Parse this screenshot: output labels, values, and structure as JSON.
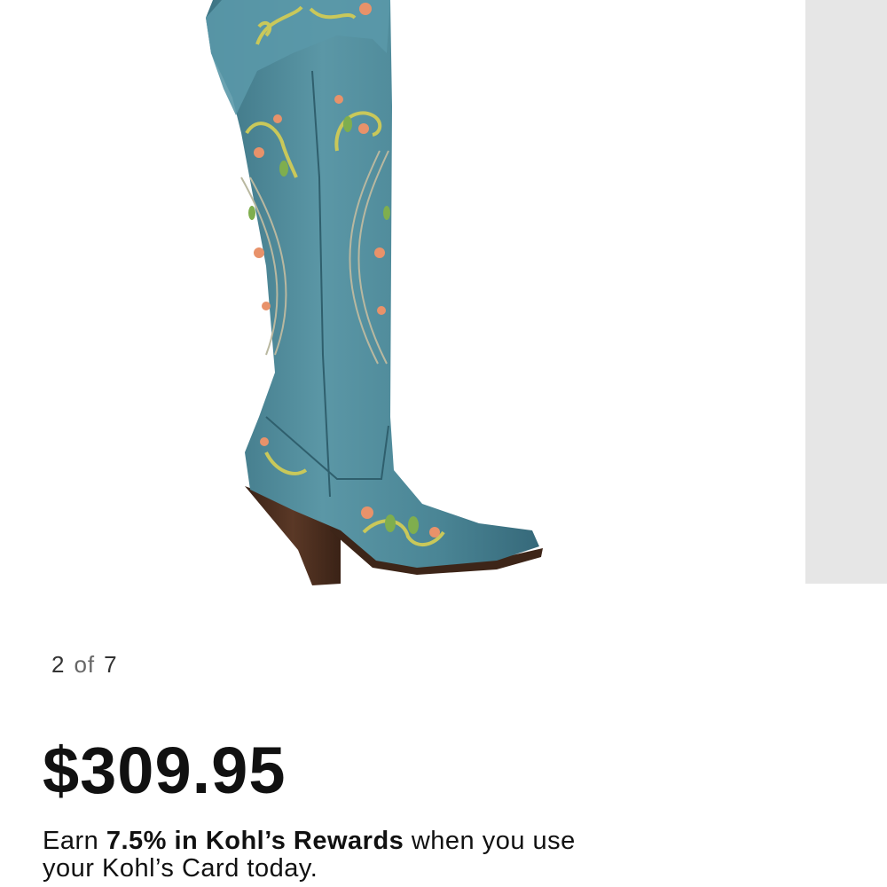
{
  "gallery": {
    "current": "2",
    "separator": "of",
    "total": "7"
  },
  "product": {
    "price": "$309.95"
  },
  "rewards": {
    "prefix": "Earn ",
    "highlight": "7.5% in Kohl’s Rewards",
    "suffix": " when you use your Kohl’s Card today."
  },
  "colors": {
    "boot_leather": "#4e8a99",
    "heel": "#4a2c1c",
    "next_slide_bg": "#e6e6e6"
  }
}
